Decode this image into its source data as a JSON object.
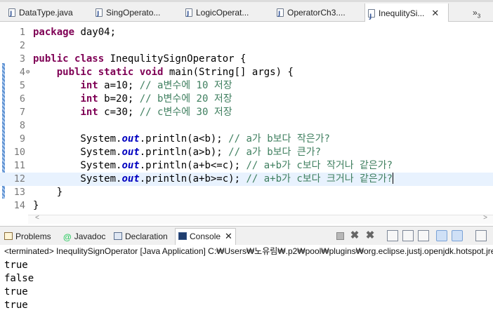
{
  "editor_tabs": [
    {
      "label": "DataType.java"
    },
    {
      "label": "SingOperato..."
    },
    {
      "label": "LogicOperat..."
    },
    {
      "label": "OperatorCh3...."
    },
    {
      "label": "InequlitySi..."
    }
  ],
  "overflow_tabs": {
    "label": "»",
    "count": "3"
  },
  "code_lines": [
    {
      "n": "1",
      "parts": [
        [
          "kw",
          "package"
        ],
        [
          "t",
          " day04;"
        ]
      ]
    },
    {
      "n": "2",
      "parts": []
    },
    {
      "n": "3",
      "parts": [
        [
          "kw",
          "public"
        ],
        [
          "t",
          " "
        ],
        [
          "kw",
          "class"
        ],
        [
          "t",
          " InequlitySignOperator {"
        ]
      ]
    },
    {
      "n": "4",
      "parts": [
        [
          "t",
          "    "
        ],
        [
          "kw",
          "public"
        ],
        [
          "t",
          " "
        ],
        [
          "kw",
          "static"
        ],
        [
          "t",
          " "
        ],
        [
          "kw",
          "void"
        ],
        [
          "t",
          " main(String[] args) {"
        ]
      ]
    },
    {
      "n": "5",
      "parts": [
        [
          "t",
          "        "
        ],
        [
          "kw",
          "int"
        ],
        [
          "t",
          " a=10; "
        ],
        [
          "cm",
          "// a변수에 10 저장"
        ]
      ]
    },
    {
      "n": "6",
      "parts": [
        [
          "t",
          "        "
        ],
        [
          "kw",
          "int"
        ],
        [
          "t",
          " b=20; "
        ],
        [
          "cm",
          "// b변수에 20 저장"
        ]
      ]
    },
    {
      "n": "7",
      "parts": [
        [
          "t",
          "        "
        ],
        [
          "kw",
          "int"
        ],
        [
          "t",
          " c=30; "
        ],
        [
          "cm",
          "// c변수에 30 저장"
        ]
      ]
    },
    {
      "n": "8",
      "parts": []
    },
    {
      "n": "9",
      "parts": [
        [
          "t",
          "        System."
        ],
        [
          "fld",
          "out"
        ],
        [
          "t",
          ".println(a<b); "
        ],
        [
          "cm",
          "// a가 b보다 작은가?"
        ]
      ]
    },
    {
      "n": "10",
      "parts": [
        [
          "t",
          "        System."
        ],
        [
          "fld",
          "out"
        ],
        [
          "t",
          ".println(a>b); "
        ],
        [
          "cm",
          "// a가 b보다 큰가?"
        ]
      ]
    },
    {
      "n": "11",
      "parts": [
        [
          "t",
          "        System."
        ],
        [
          "fld",
          "out"
        ],
        [
          "t",
          ".println(a+b<=c); "
        ],
        [
          "cm",
          "// a+b가 c보다 작거나 같은가?"
        ]
      ]
    },
    {
      "n": "12",
      "parts": [
        [
          "t",
          "        System."
        ],
        [
          "fld",
          "out"
        ],
        [
          "t",
          ".println(a+b>=c); "
        ],
        [
          "cm",
          "// a+b가 c보다 크거나 같은가?"
        ]
      ]
    },
    {
      "n": "13",
      "parts": [
        [
          "t",
          "    }"
        ]
      ]
    },
    {
      "n": "14",
      "parts": [
        [
          "t",
          "}"
        ]
      ]
    }
  ],
  "current_line": "12",
  "fold_marker_line": "4",
  "view_tabs": [
    {
      "label": "Problems",
      "icon": "problems-icon"
    },
    {
      "label": "Javadoc",
      "icon": "javadoc-icon"
    },
    {
      "label": "Declaration",
      "icon": "declaration-icon"
    },
    {
      "label": "Console",
      "icon": "console-icon"
    }
  ],
  "console": {
    "status": "<terminated> InequlitySignOperator [Java Application] C:₩Users₩노유림₩.p2₩pool₩plugins₩org.eclipse.justj.openjdk.hotspot.jre.",
    "output": [
      "true",
      "false",
      "true",
      "true"
    ]
  },
  "colors": {
    "keyword": "#7f0055",
    "comment": "#3f7f5f",
    "field": "#0000c0",
    "current_line_bg": "#e8f2fe",
    "line_number": "#787878"
  }
}
